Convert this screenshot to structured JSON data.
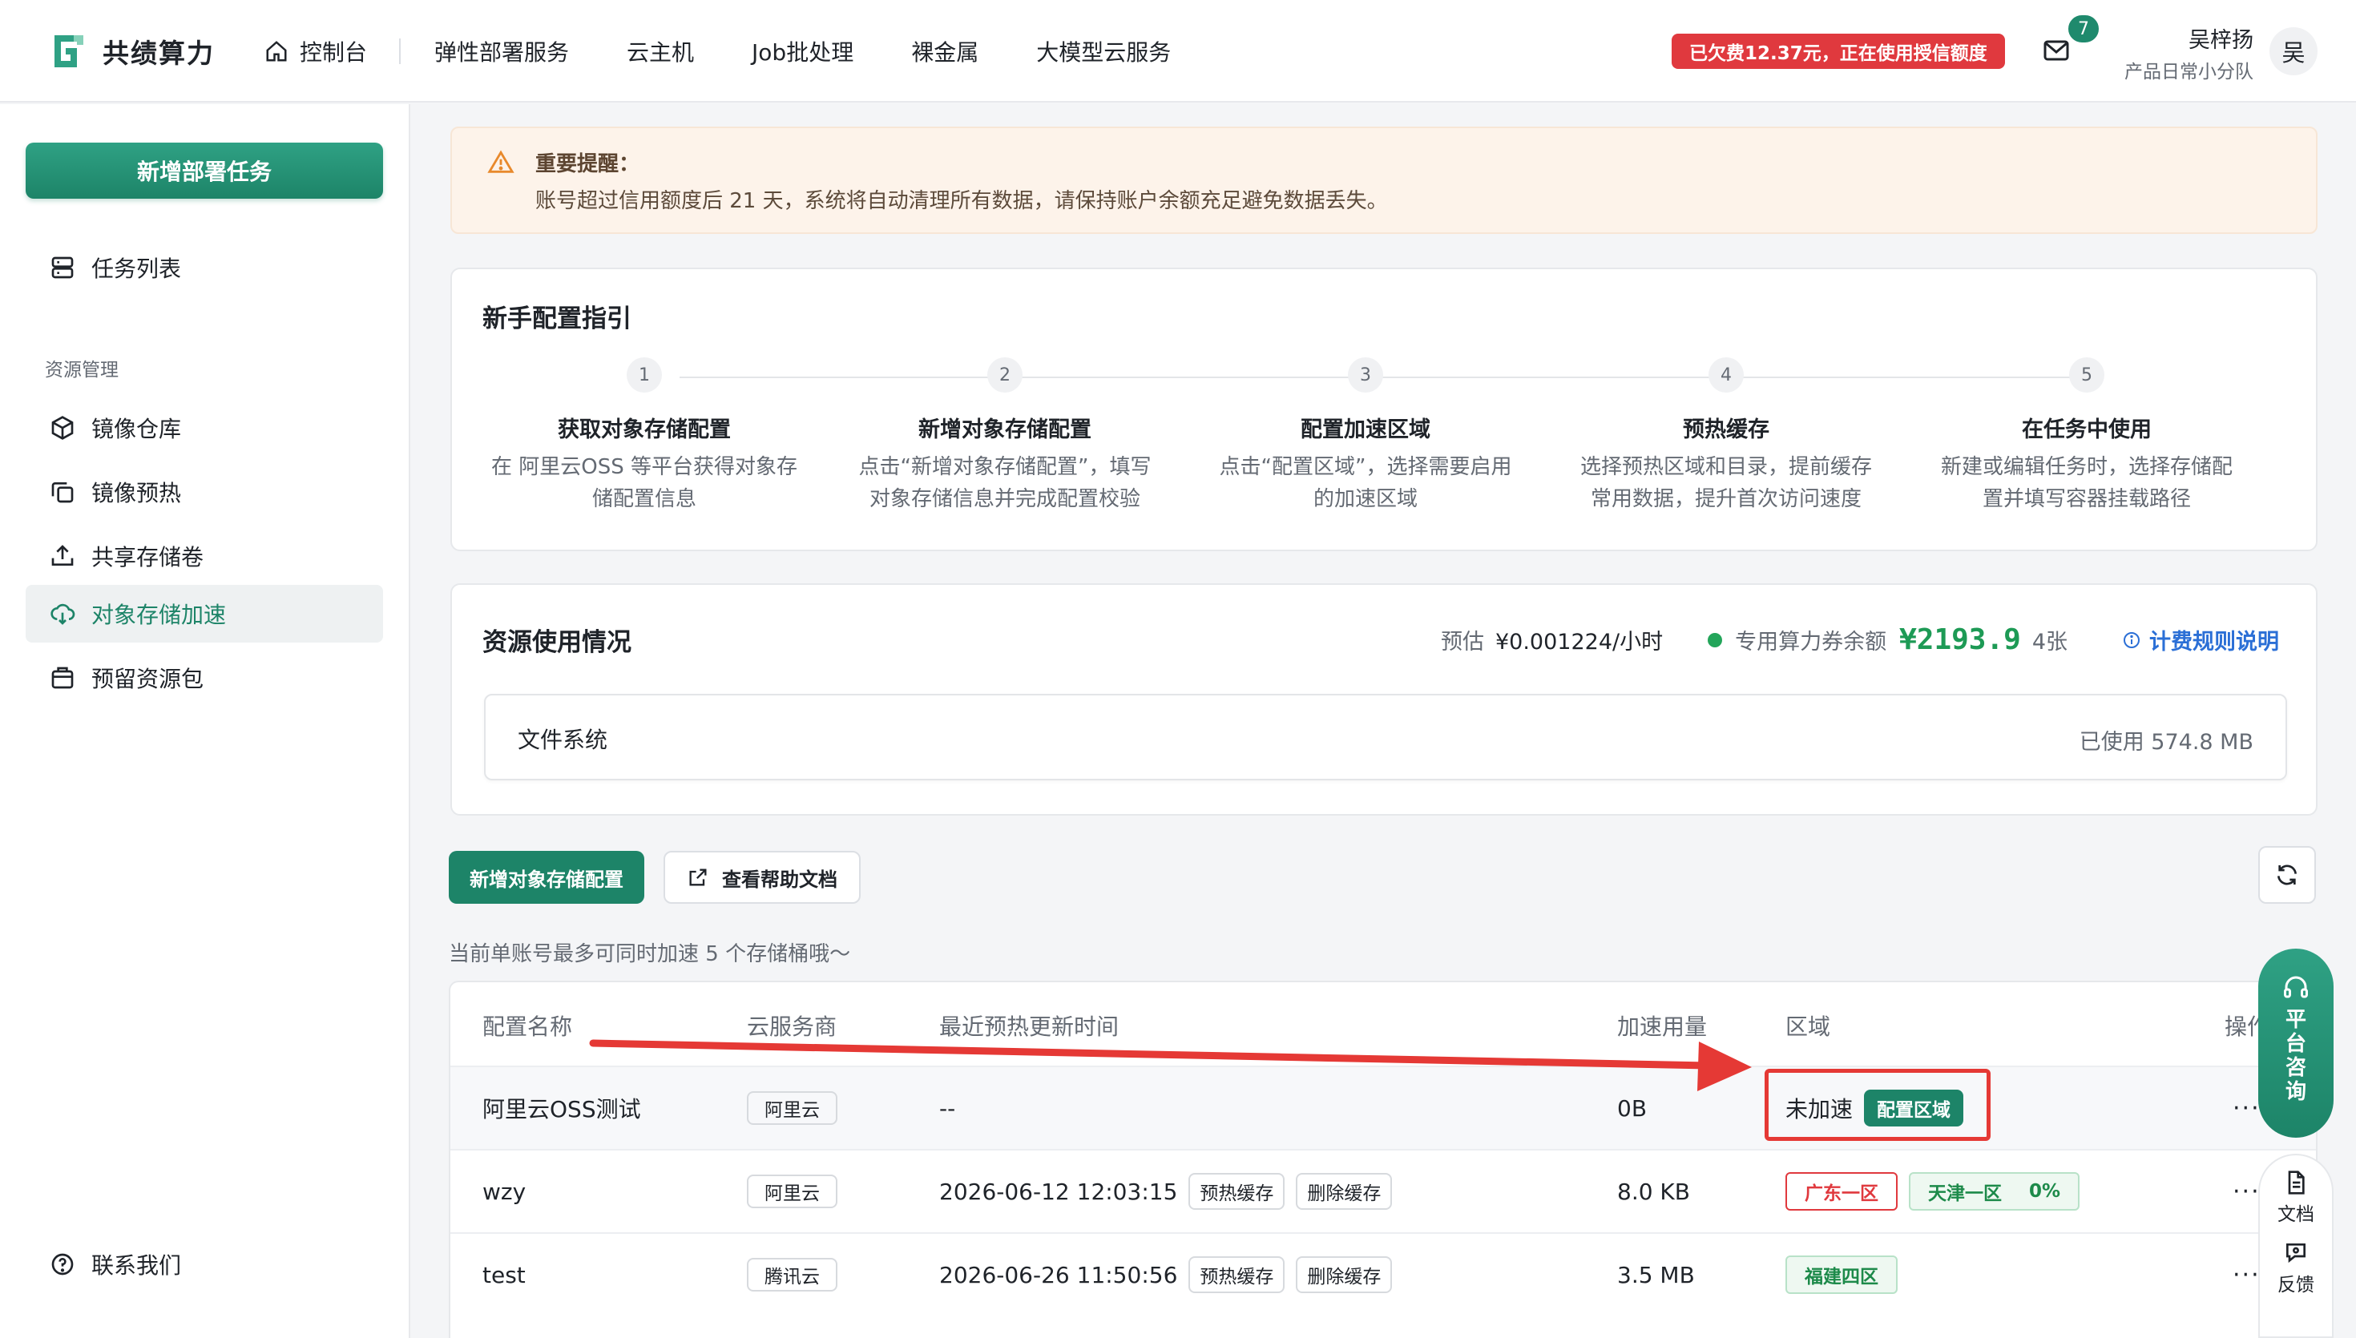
{
  "brand": {
    "name": "共绩算力",
    "accent": "#1d8468"
  },
  "nav": {
    "home": "控制台",
    "items": [
      "弹性部署服务",
      "云主机",
      "Job批处理",
      "裸金属",
      "大模型云服务"
    ]
  },
  "header": {
    "arrears": "已欠费12.37元，正在使用授信额度",
    "mail_count": "7",
    "user_name": "吴梓扬",
    "user_team": "产品日常小分队",
    "avatar_text": "吴"
  },
  "sidebar": {
    "primary_action": "新增部署任务",
    "task_list": "任务列表",
    "group_label": "资源管理",
    "items": [
      "镜像仓库",
      "镜像预热",
      "共享存储卷",
      "对象存储加速",
      "预留资源包"
    ],
    "active": "对象存储加速",
    "contact": "联系我们"
  },
  "notice": {
    "title": "重要提醒：",
    "text": "账号超过信用额度后 21 天，系统将自动清理所有数据，请保持账户余额充足避免数据丢失。"
  },
  "guide": {
    "title": "新手配置指引",
    "steps": [
      {
        "num": "1",
        "title": "获取对象存储配置",
        "desc1": "在 阿里云OSS 等平台获得对象存",
        "desc2": "储配置信息"
      },
      {
        "num": "2",
        "title": "新增对象存储配置",
        "desc1": "点击“新增对象存储配置”，填写",
        "desc2": "对象存储信息并完成配置校验"
      },
      {
        "num": "3",
        "title": "配置加速区域",
        "desc1": "点击“配置区域”，选择需要启用",
        "desc2": "的加速区域"
      },
      {
        "num": "4",
        "title": "预热缓存",
        "desc1": "选择预热区域和目录，提前缓存",
        "desc2": "常用数据，提升首次访问速度"
      },
      {
        "num": "5",
        "title": "在任务中使用",
        "desc1": "新建或编辑任务时，选择存储配",
        "desc2": "置并填写容器挂载路径"
      }
    ]
  },
  "usage": {
    "title": "资源使用情况",
    "estimate_label": "预估",
    "estimate_value": "¥0.001224/小时",
    "voucher_label": "专用算力券余额",
    "voucher_value": "¥2193.9",
    "voucher_count": "4张",
    "rule_link": "计费规则说明",
    "fs_label": "文件系统",
    "fs_used": "已使用 574.8 MB"
  },
  "toolbar": {
    "add_label": "新增对象存储配置",
    "doc_label": "查看帮助文档",
    "hint": "当前单账号最多可同时加速 5 个存储桶哦～"
  },
  "table": {
    "headers": [
      "配置名称",
      "云服务商",
      "最近预热更新时间",
      "加速用量",
      "区域",
      "操作"
    ],
    "rows": [
      {
        "name": "阿里云OSS测试",
        "provider": "阿里云",
        "time": "--",
        "usage": "0B",
        "region_text": "未加速",
        "region_btn": "配置区域"
      },
      {
        "name": "wzy",
        "provider": "阿里云",
        "time": "2026-06-12 12:03:15",
        "preheat": "预热缓存",
        "delete": "删除缓存",
        "usage": "8.0 KB",
        "regions": [
          {
            "name": "广东一区",
            "style": "red"
          },
          {
            "name": "天津一区",
            "pct": "0%",
            "style": "green"
          }
        ]
      },
      {
        "name": "test",
        "provider": "腾讯云",
        "time": "2026-06-26 11:50:56",
        "preheat": "预热缓存",
        "delete": "删除缓存",
        "usage": "3.5 MB",
        "regions": [
          {
            "name": "福建四区",
            "style": "green"
          }
        ]
      }
    ],
    "more": "···"
  },
  "floating": {
    "consult_chars": [
      "平",
      "台",
      "咨",
      "询"
    ],
    "doc": "文档",
    "feedback": "反馈"
  }
}
